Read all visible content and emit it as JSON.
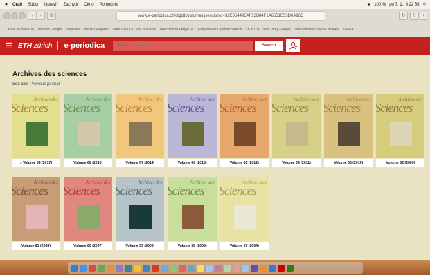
{
  "menubar": {
    "apple": "",
    "items": [
      "Grab",
      "Súbor",
      "Upraviť",
      "Zachytiť",
      "Okno",
      "Pomocník"
    ],
    "status": [
      "100 %",
      "po 7. 1., 9 22 56"
    ]
  },
  "browser": {
    "url": "www.e-periodica.ch/digbib/volumes;jsessionid=32E054495AF13B84F1A6551E53D0A96C",
    "bookmarks": [
      "Prek pri zaviazlo",
      "Preklad Google",
      "translator - Hledat Googlem",
      "Little Lake Lu, Jan, Slovakia",
      "Welcome to Empyr v2",
      "Early Modern..period Search",
      "ODBT ITO sud...arny Google",
      "internationáln..ťavná stránka",
      "e-MOA"
    ]
  },
  "header": {
    "logo_bold": "ETH",
    "logo_rest": "zürich",
    "site": "e-periodica",
    "search_placeholder": "Search in full text",
    "search_button": "Search"
  },
  "page": {
    "title": "Archives des sciences",
    "see_also": "See also",
    "previous_journal": "Previous journal"
  },
  "volumes": [
    {
      "label": "Volume 69 (2017)",
      "bg": "#e4df8d",
      "sci": "#a0863f",
      "pic": "#4a7a3a",
      "lock": true
    },
    {
      "label": "Volume 68 (2015)",
      "bg": "#a7cfa6",
      "sci": "#6f8d53",
      "pic": "#d2c9a9",
      "lock": false
    },
    {
      "label": "Volume 67 (2014)",
      "bg": "#f1c67d",
      "sci": "#c4853d",
      "pic": "#8a7a5a",
      "lock": false
    },
    {
      "label": "Volume 66 (2013)",
      "bg": "#bcb7d6",
      "sci": "#5d5a93",
      "pic": "#6b6a3a",
      "lock": false
    },
    {
      "label": "Volume 65 (2012)",
      "bg": "#e9a86b",
      "sci": "#b25d35",
      "pic": "#7a4a2a",
      "lock": false
    },
    {
      "label": "Volume 64 (2011)",
      "bg": "#d7d088",
      "sci": "#8d8840",
      "pic": "#c7b98a",
      "lock": false
    },
    {
      "label": "Volume 63 (2010)",
      "bg": "#d9c281",
      "sci": "#a0853b",
      "pic": "#5a4a3a",
      "lock": false
    },
    {
      "label": "Volume 62 (2009)",
      "bg": "#d6cc7c",
      "sci": "#8a8040",
      "pic": "#dcd4b4",
      "lock": false
    },
    {
      "label": "Volume 61 (2008)",
      "bg": "#c99c78",
      "sci": "#7c5439",
      "pic": "#e3b5b5",
      "lock": false
    },
    {
      "label": "Volume 60 (2007)",
      "bg": "#e0877f",
      "sci": "#b63b3d",
      "pic": "#8aaa6a",
      "lock": false
    },
    {
      "label": "Volume 59 (2006)",
      "bg": "#b6c3c7",
      "sci": "#5a7277",
      "pic": "#1a3a3a",
      "lock": false
    },
    {
      "label": "Volume 58 (2005)",
      "bg": "#c8de9b",
      "sci": "#6f8c45",
      "pic": "#8a5a3a",
      "lock": false
    },
    {
      "label": "Volume 57 (2004)",
      "bg": "#e8e2a3",
      "sci": "#a19b56",
      "pic": "#ece8d8",
      "lock": false
    }
  ]
}
